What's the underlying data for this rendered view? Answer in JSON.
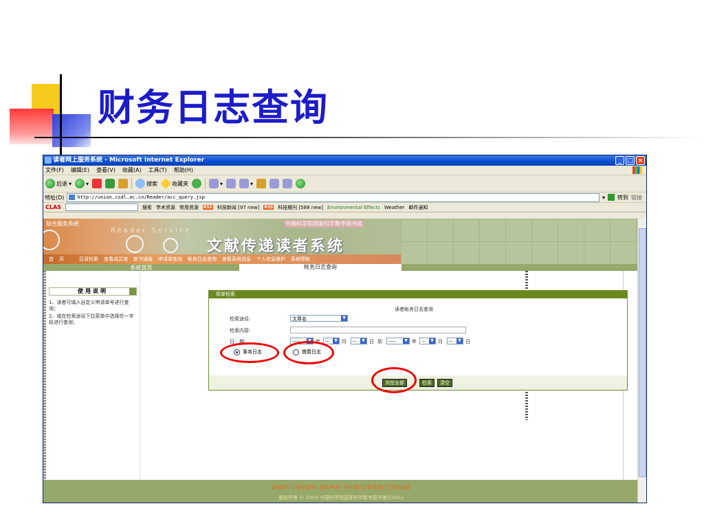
{
  "slide": {
    "title": "财务日志查询"
  },
  "window": {
    "title": "读者网上服务系统 - Microsoft Internet Explorer",
    "min": "_",
    "max": "□",
    "close": "×"
  },
  "menubar": [
    "文件(F)",
    "编辑(E)",
    "查看(V)",
    "收藏(A)",
    "工具(T)",
    "帮助(H)"
  ],
  "toolbar": {
    "back": "后退",
    "search": "搜索",
    "favorites": "收藏夹"
  },
  "address": {
    "label": "地址(D)",
    "url": "http://union.csdl.ac.cn/Reader/acc_query.jsp",
    "go": "转到",
    "links": "链接"
  },
  "linksbar": {
    "clas": "CLAS",
    "search": "搜索",
    "academic": "学术资源",
    "common": "常用资源",
    "rss": "RSS",
    "news": "科技新闻 [97 new]",
    "journals": "科技期刊 [588 new]",
    "env": "Environmental Effects",
    "weather": "Weather",
    "mail": "邮件通知"
  },
  "banner": {
    "union": "联合服务系统",
    "reader_service": "Reader Service",
    "library": "中国科学院国家科学数字图书馆",
    "system_title": "文献传递读者系统"
  },
  "nav": {
    "home": "首页",
    "items": [
      "目录检索",
      "查看成员馆",
      "新书通报",
      "申请单查询",
      "帐务日志查询",
      "查看系统消息",
      "个人信息维护",
      "系统帮助"
    ]
  },
  "subnav": {
    "home": "系统首页",
    "current": "帐务日志查询"
  },
  "usage": {
    "title": "使用说明",
    "line1": "1、读者可填入自定义申请单号进行查询；",
    "line2": "2、或在检索途径下拉菜单中选择任一字段进行查询；"
  },
  "search_panel": {
    "header": "简单检索",
    "caption": "读者帐务日志查询",
    "path_label": "检索途径:",
    "path_value": "文章名",
    "content_label": "检索内容:",
    "date_label": "日　期:",
    "date_placeholder": "----",
    "date_short_placeholder": "--",
    "year": "年",
    "month": "月",
    "day": "日",
    "to": "到",
    "radio_transaction": "事务日志",
    "radio_payment": "缴费日志",
    "btn_all": "浏览全部",
    "btn_search": "检索",
    "btn_clear": "清空"
  },
  "footer": {
    "links": "系统简介 | 版权说明 | 隐私声明 | 关于我们 | 联系我们 | 网站地图",
    "copyright": "版权所有 © 2003 中国科学院国家科学数字图书馆(CSDL)"
  },
  "colors": {
    "accent": "#6a8a1e",
    "annotation": "#e00000",
    "title": "#1c1cc8"
  }
}
